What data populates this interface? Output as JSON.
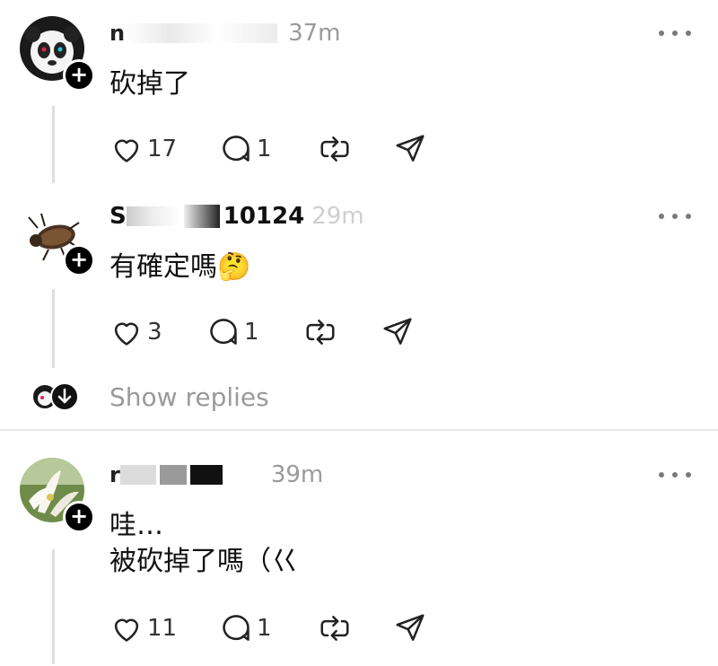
{
  "posts": [
    {
      "username": "n",
      "time": "37m",
      "body": "砍掉了",
      "likes": "17",
      "replies": "1",
      "avatar_icon": "panda-avatar-icon"
    },
    {
      "username": "S",
      "username_visible": "10124",
      "time": "29m",
      "body": "有確定嗎🤔",
      "likes": "3",
      "replies": "1",
      "avatar_icon": "beetle-avatar-icon"
    },
    {
      "username": "r",
      "time": "39m",
      "body": "哇…\n被砍掉了嗎（巜",
      "likes": "11",
      "replies": "1",
      "avatar_icon": "flower-avatar-icon"
    }
  ],
  "show_replies_label": "Show replies",
  "colors": {
    "muted": "#9a9a9a",
    "divider": "#e6e6e6",
    "thread_line": "#dedede"
  }
}
